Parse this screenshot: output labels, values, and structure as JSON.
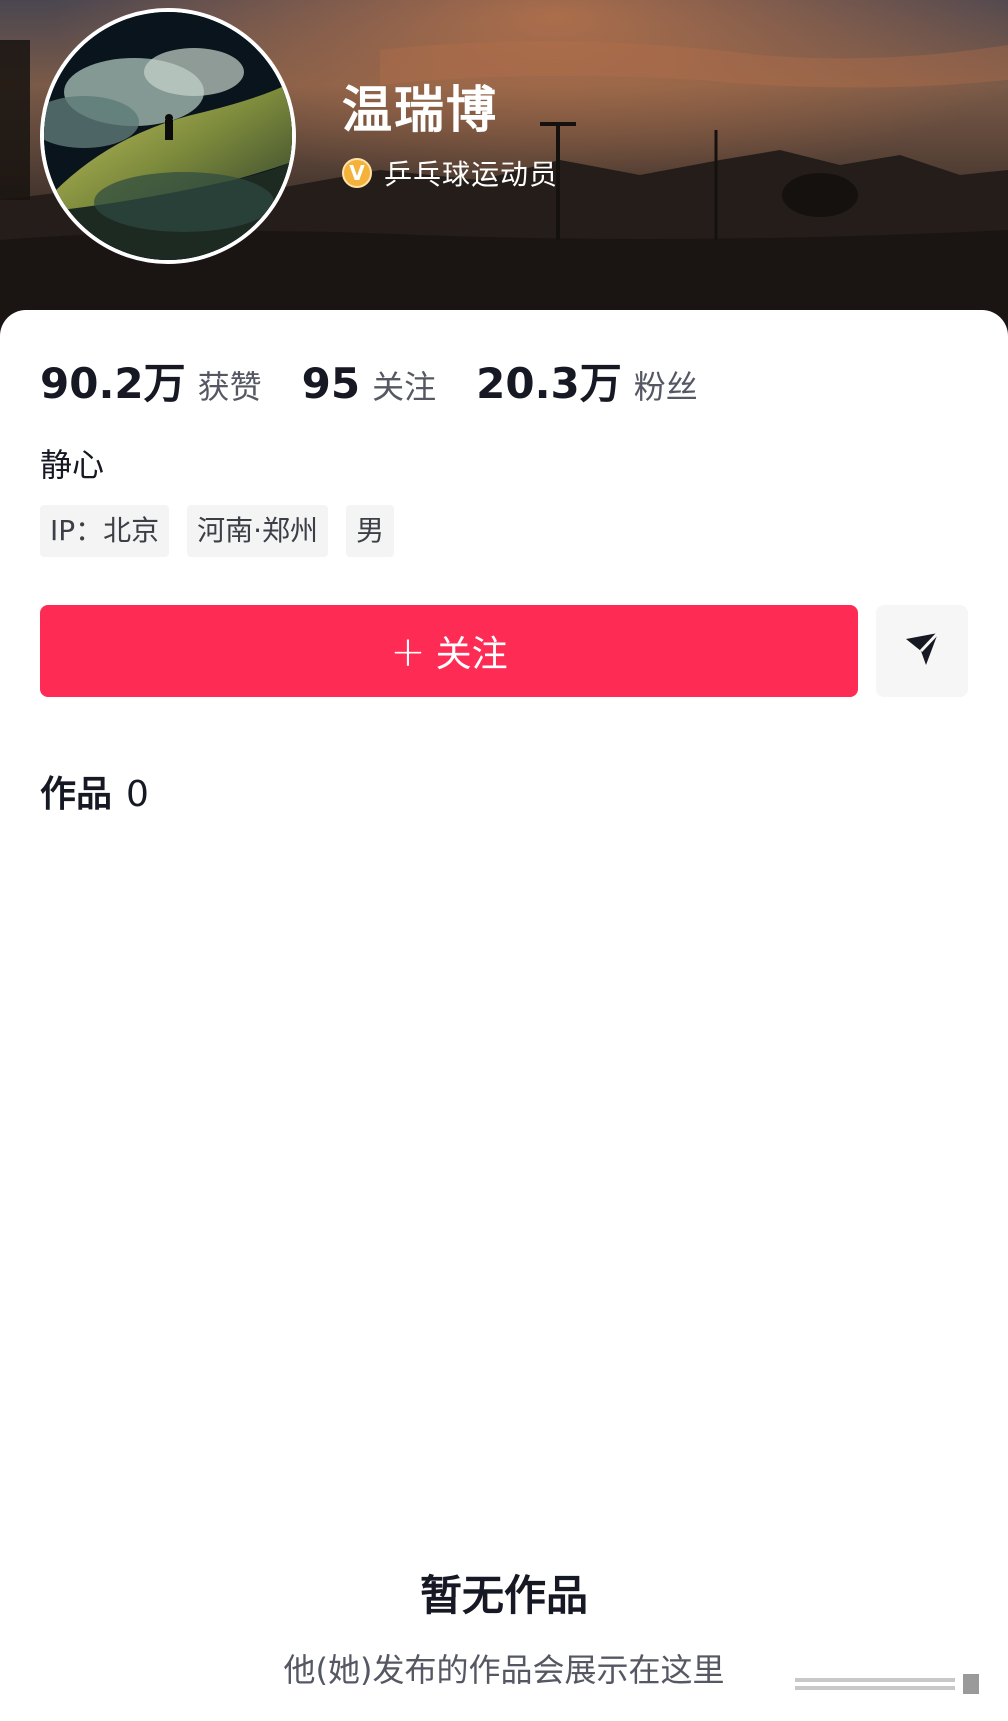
{
  "profile": {
    "name": "温瑞博",
    "verification": "乒乓球运动员",
    "verify_icon": "verified-v-icon",
    "verify_symbol": "V",
    "bio": "静心"
  },
  "stats": [
    {
      "value": "90.2万",
      "label": "获赞"
    },
    {
      "value": "95",
      "label": "关注"
    },
    {
      "value": "20.3万",
      "label": "粉丝"
    }
  ],
  "tags": [
    "IP：北京",
    "河南·郑州",
    "男"
  ],
  "actions": {
    "follow_plus": "+",
    "follow_label": "关注",
    "share_icon": "send-icon"
  },
  "works": {
    "label": "作品",
    "count": "0"
  },
  "empty_state": {
    "title": "暂无作品",
    "subtitle": "他(她)发布的作品会展示在这里"
  },
  "colors": {
    "accent": "#fe2c55",
    "text_primary": "#161823",
    "text_secondary": "#555863"
  }
}
